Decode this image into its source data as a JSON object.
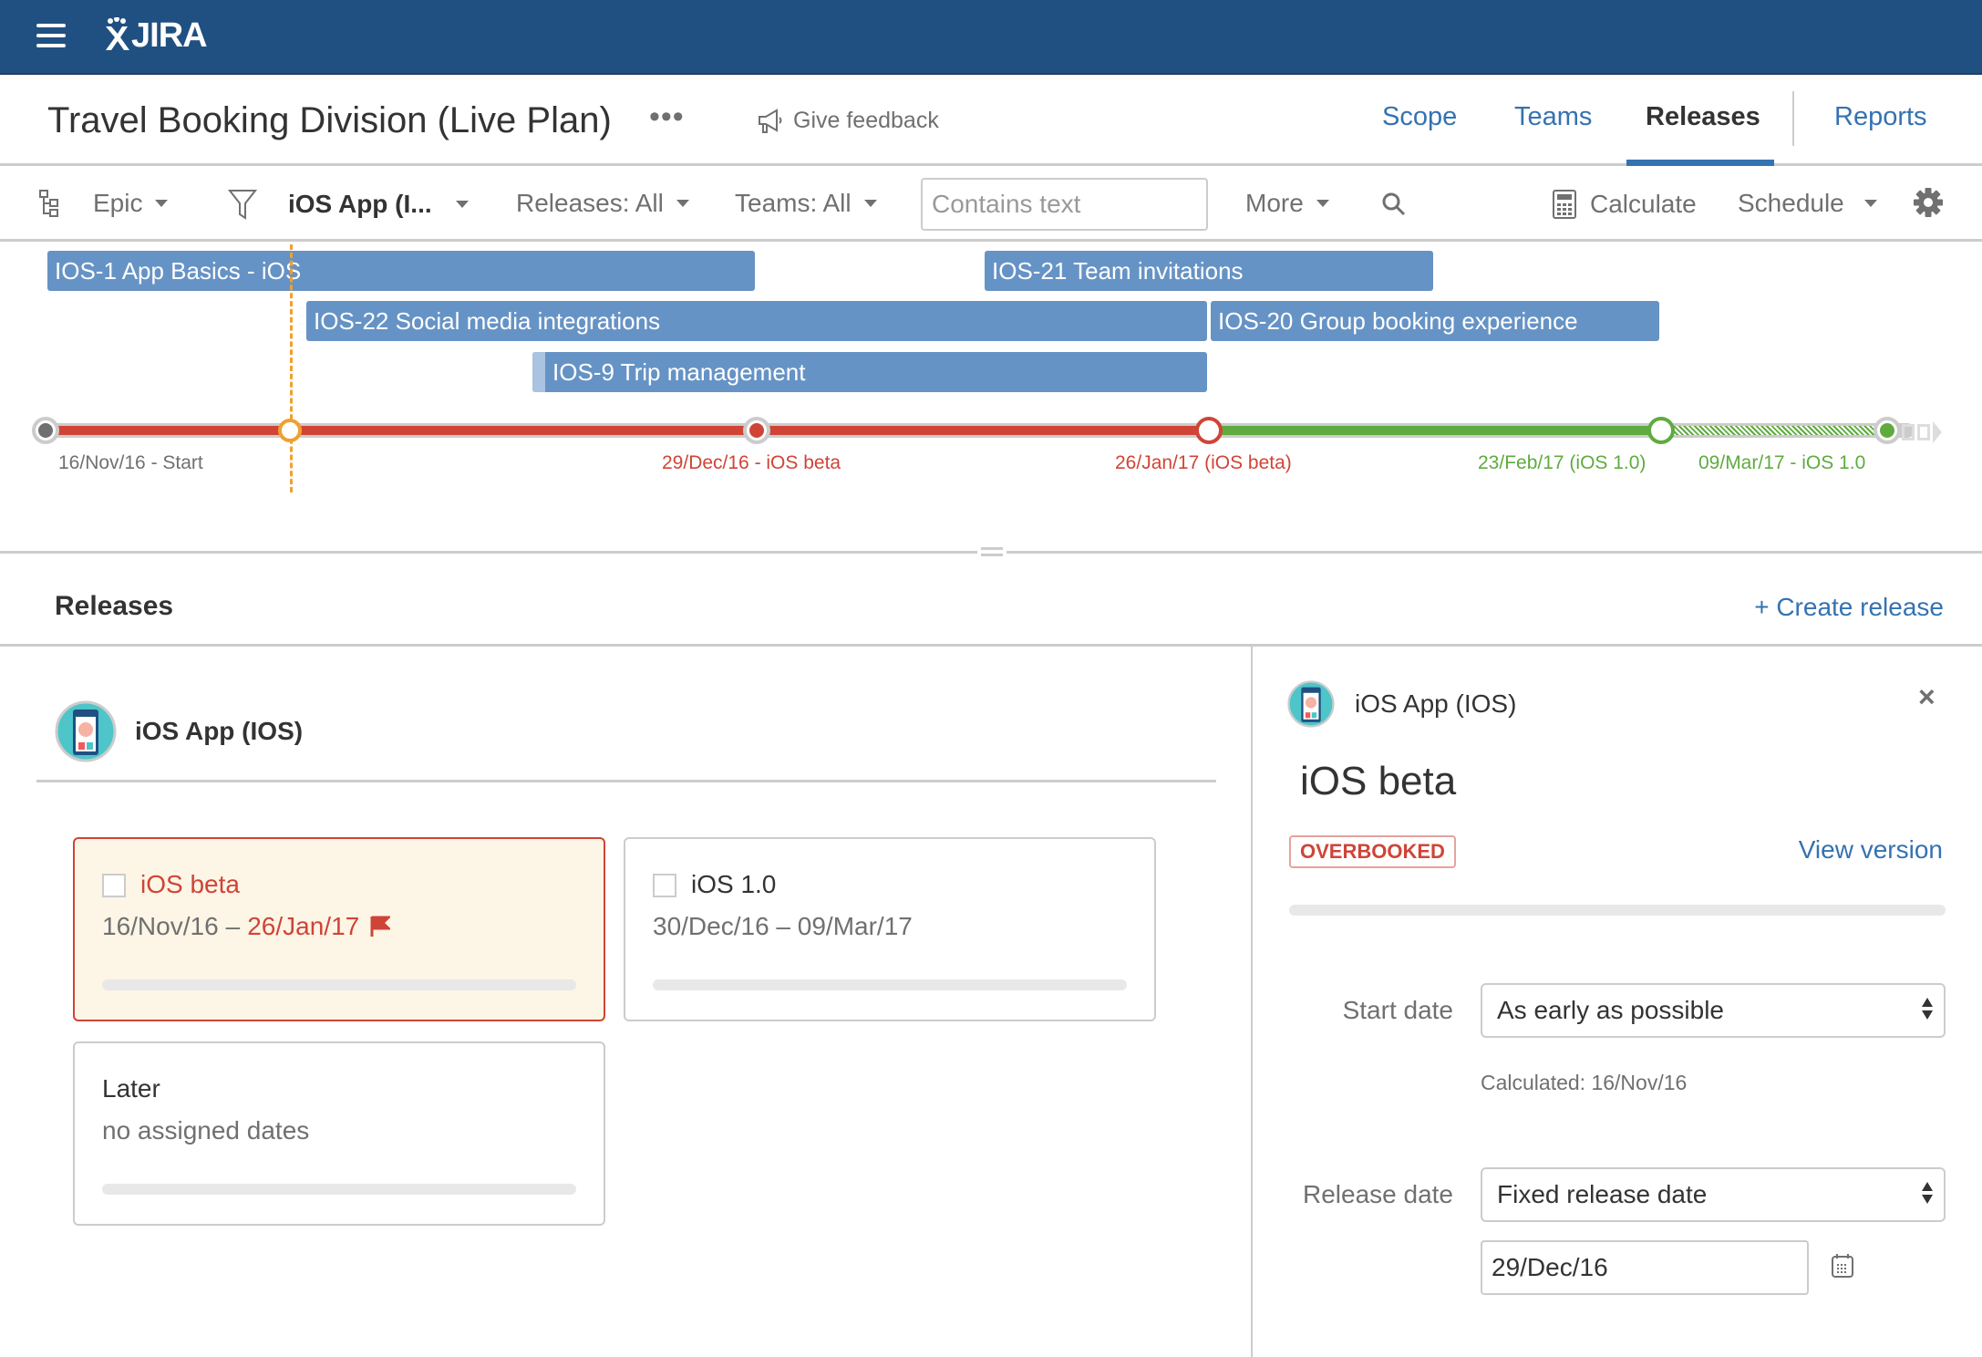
{
  "app": {
    "logo_text": "JIRA"
  },
  "header": {
    "title": "Travel Booking Division (Live Plan)",
    "more_label": "•••",
    "feedback_label": "Give feedback",
    "tabs": [
      {
        "label": "Scope",
        "active": false
      },
      {
        "label": "Teams",
        "active": false
      },
      {
        "label": "Releases",
        "active": true
      },
      {
        "label": "Reports",
        "active": false
      }
    ]
  },
  "toolbar": {
    "hierarchy_label": "Epic",
    "project_filter": "iOS App (I...",
    "releases_filter": "Releases: All",
    "teams_filter": "Teams: All",
    "search_placeholder": "Contains text",
    "search_value": "",
    "more_label": "More",
    "calculate_label": "Calculate",
    "schedule_label": "Schedule"
  },
  "timeline": {
    "epics": [
      {
        "label": "IOS-1 App Basics - iOS",
        "row": 0
      },
      {
        "label": "IOS-21 Team invitations",
        "row": 0
      },
      {
        "label": "IOS-22 Social media integrations",
        "row": 1
      },
      {
        "label": "IOS-20 Group booking experience",
        "row": 1
      },
      {
        "label": "IOS-9 Trip management",
        "row": 2
      }
    ],
    "milestones": [
      {
        "label": "16/Nov/16 - Start",
        "status": "start",
        "color": "#707070"
      },
      {
        "label": "",
        "status": "today",
        "color": "#f0a030"
      },
      {
        "label": "29/Dec/16 - iOS beta",
        "status": "release",
        "color": "#d04437"
      },
      {
        "label": "26/Jan/17 (iOS beta)",
        "status": "projected",
        "color": "#d04437"
      },
      {
        "label": "23/Feb/17 (iOS 1.0)",
        "status": "projected",
        "color": "#5fab3f"
      },
      {
        "label": "09/Mar/17 - iOS 1.0",
        "status": "release",
        "color": "#5fab3f"
      }
    ]
  },
  "releases": {
    "title": "Releases",
    "create_label": "+ Create release",
    "project_name": "iOS App (IOS)",
    "cards": [
      {
        "name": "iOS beta",
        "start": "16/Nov/16",
        "separator": "–",
        "end": "26/Jan/17",
        "overbooked": true,
        "progress": 0
      },
      {
        "name": "iOS 1.0",
        "dates": "30/Dec/16 – 09/Mar/17",
        "overbooked": false,
        "progress": 0
      },
      {
        "name": "Later",
        "dates": "no assigned dates",
        "progress": 0
      }
    ]
  },
  "detail": {
    "project_name": "iOS App (IOS)",
    "title": "iOS beta",
    "badge": "OVERBOOKED",
    "view_version_label": "View version",
    "progress": 0,
    "start_date_label": "Start date",
    "start_date_value": "As early as possible",
    "calculated_text": "Calculated: 16/Nov/16",
    "release_date_label": "Release date",
    "release_date_mode": "Fixed release date",
    "release_date_value": "29/Dec/16",
    "close_label": "×"
  },
  "colors": {
    "brand": "#205081",
    "link": "#3572b0",
    "epic": "#6693c5",
    "late": "#d04437",
    "on_track": "#5fab3f",
    "today": "#f0a030"
  }
}
